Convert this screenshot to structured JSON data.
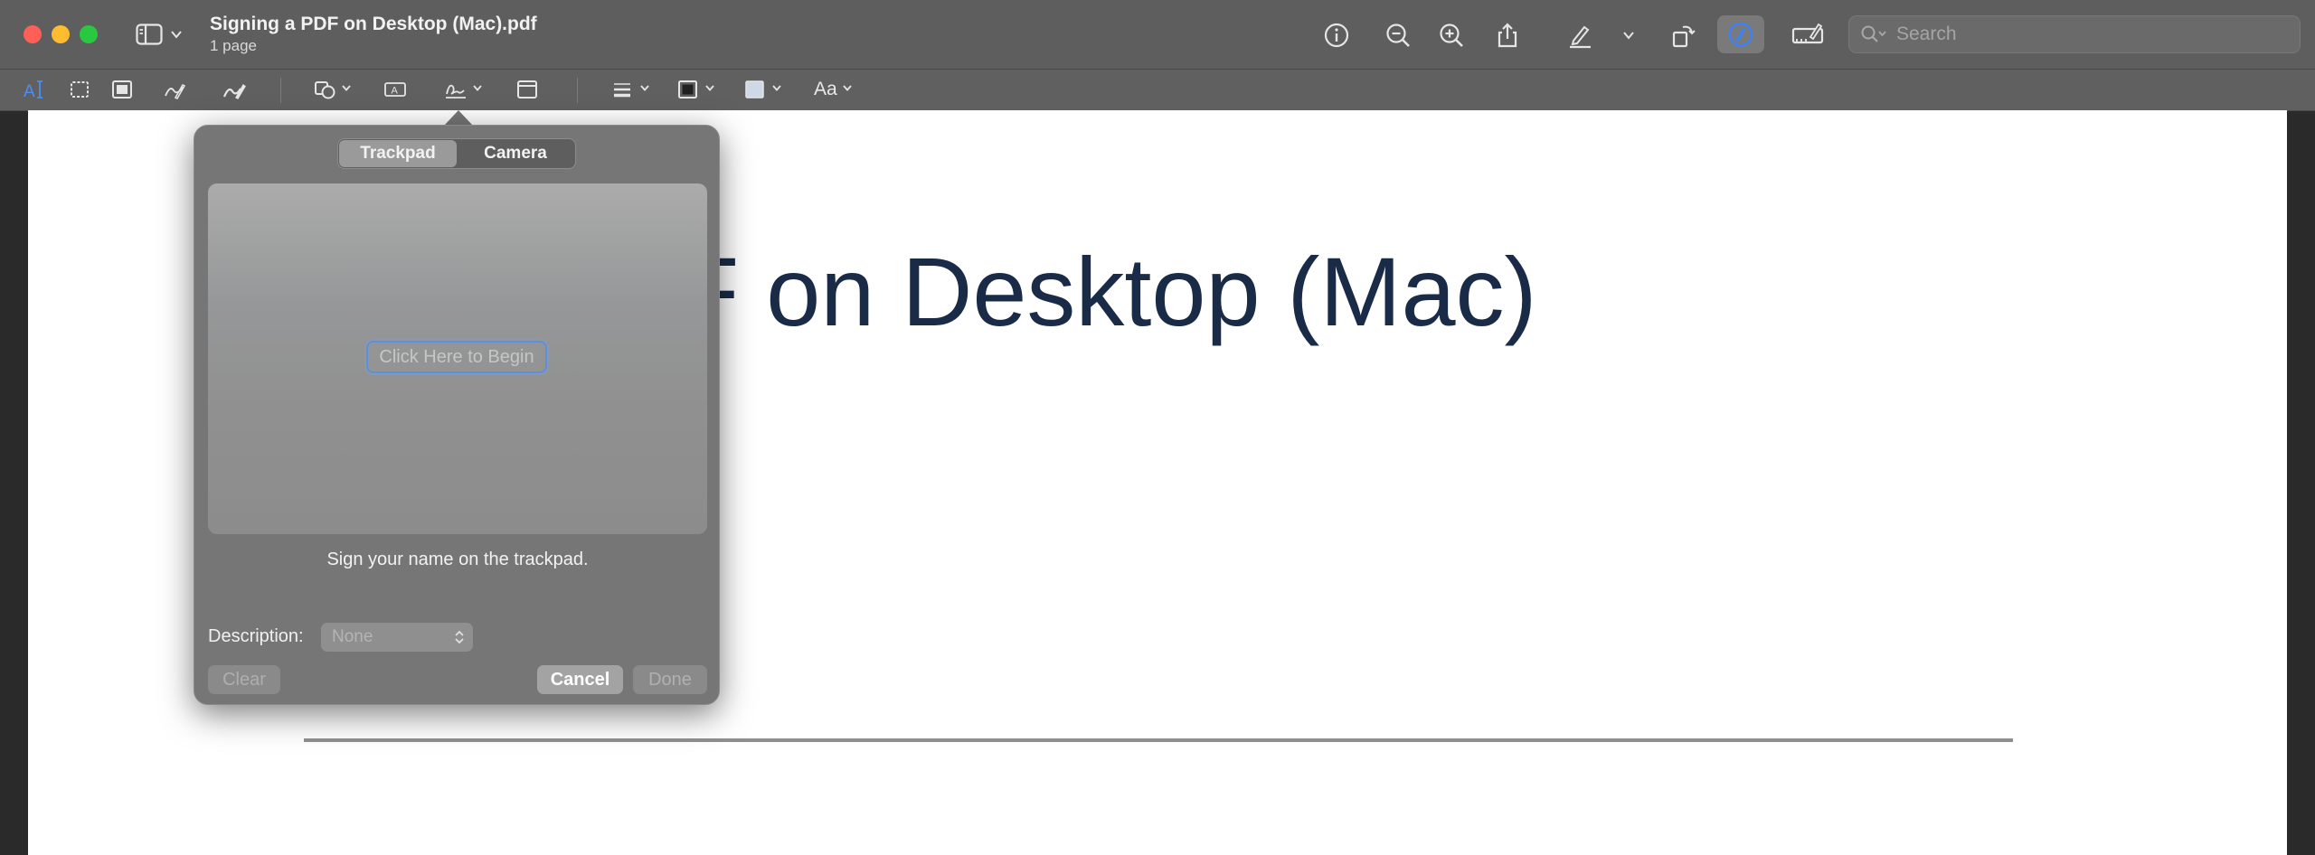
{
  "window": {
    "title": "Signing a PDF on Desktop (Mac).pdf",
    "subtitle": "1 page"
  },
  "toolbar": {
    "icons": [
      "sidebar-icon",
      "info-icon",
      "zoom-out-icon",
      "zoom-in-icon",
      "share-icon",
      "highlight-pen-icon",
      "rotate-icon",
      "markup-icon",
      "form-fill-icon"
    ],
    "search_placeholder": "Search"
  },
  "markup_toolbar": {
    "icons": [
      "text-selection-icon",
      "rect-selection-icon",
      "instant-alpha-icon",
      "sketch-icon",
      "draw-icon",
      "shapes-icon",
      "text-box-icon",
      "signature-icon",
      "note-icon",
      "line-style-icon",
      "border-color-icon",
      "fill-color-icon"
    ],
    "font_label": "Aa"
  },
  "document": {
    "heading_visible": "ng a PDF on Desktop (Mac)"
  },
  "signature_popover": {
    "tabs": [
      {
        "label": "Trackpad",
        "active": true
      },
      {
        "label": "Camera",
        "active": false
      }
    ],
    "begin_button": "Click Here to Begin",
    "hint": "Sign your name on the trackpad.",
    "description_label": "Description:",
    "description_value": "None",
    "clear_button": "Clear",
    "cancel_button": "Cancel",
    "done_button": "Done"
  },
  "colors": {
    "accent": "#3b82f6",
    "heading_text": "#1a2b48",
    "traffic_red": "#ff5f57",
    "traffic_yellow": "#febc2e",
    "traffic_green": "#28c840"
  }
}
